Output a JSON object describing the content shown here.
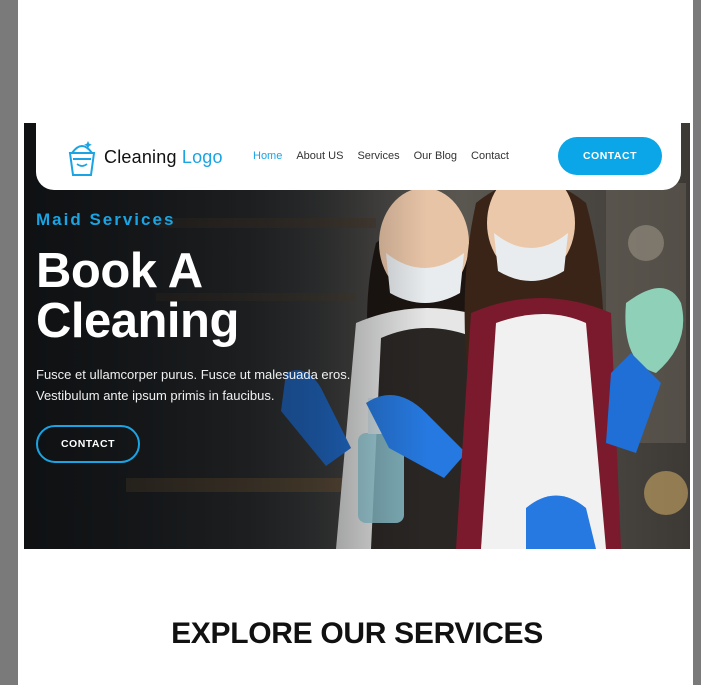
{
  "header": {
    "logo_text": "Cleaning",
    "logo_accent": "Logo",
    "logo_icon": "cleaning-bucket-icon",
    "nav": [
      "Home",
      "About US",
      "Services",
      "Our Blog",
      "Contact"
    ],
    "active_nav": "Home",
    "cta_label": "CONTACT"
  },
  "hero": {
    "eyebrow": "Maid Services",
    "headline_line1": "Book A",
    "headline_line2": "Cleaning",
    "description": "Fusce et ullamcorper purus. Fusce ut malesuada eros. Vestibulum ante ipsum primis in faucibus.",
    "cta_label": "CONTACT",
    "image": "two-cleaners-with-masks-and-gloves-photo"
  },
  "services": {
    "title": "EXPLORE OUR SERVICES"
  },
  "colors": {
    "accent": "#1aa4e4",
    "cta_fill": "#0ba6e8",
    "hero_dark": "#1a1d20"
  }
}
